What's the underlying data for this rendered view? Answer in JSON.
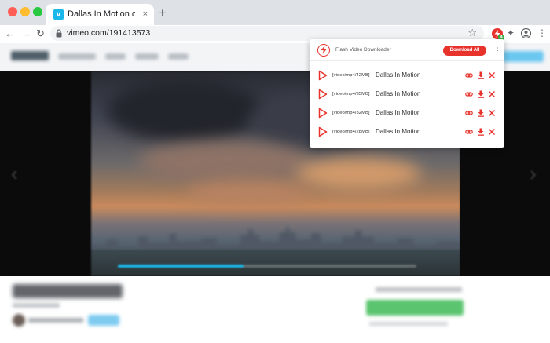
{
  "browser": {
    "tab": {
      "title": "Dallas In Motion on V",
      "favicon": "vimeo-icon",
      "close_glyph": "×"
    },
    "new_tab_glyph": "+",
    "url": "vimeo.com/191413573",
    "ext_badge": "4",
    "colors": {
      "tabbar": "#dee1e6",
      "omnibox": "#f1f3f4"
    }
  },
  "popup": {
    "title": "Flash Video Downloader",
    "download_all_label": "Download All",
    "accent": "#e8322c",
    "rows": [
      {
        "format": "[video/mp4/42MB]",
        "title": "Dallas In Motion"
      },
      {
        "format": "[video/mp4/35MB]",
        "title": "Dallas In Motion"
      },
      {
        "format": "[video/mp4/32MB]",
        "title": "Dallas In Motion"
      },
      {
        "format": "[video/mp4/28MB]",
        "title": "Dallas In Motion"
      }
    ]
  }
}
